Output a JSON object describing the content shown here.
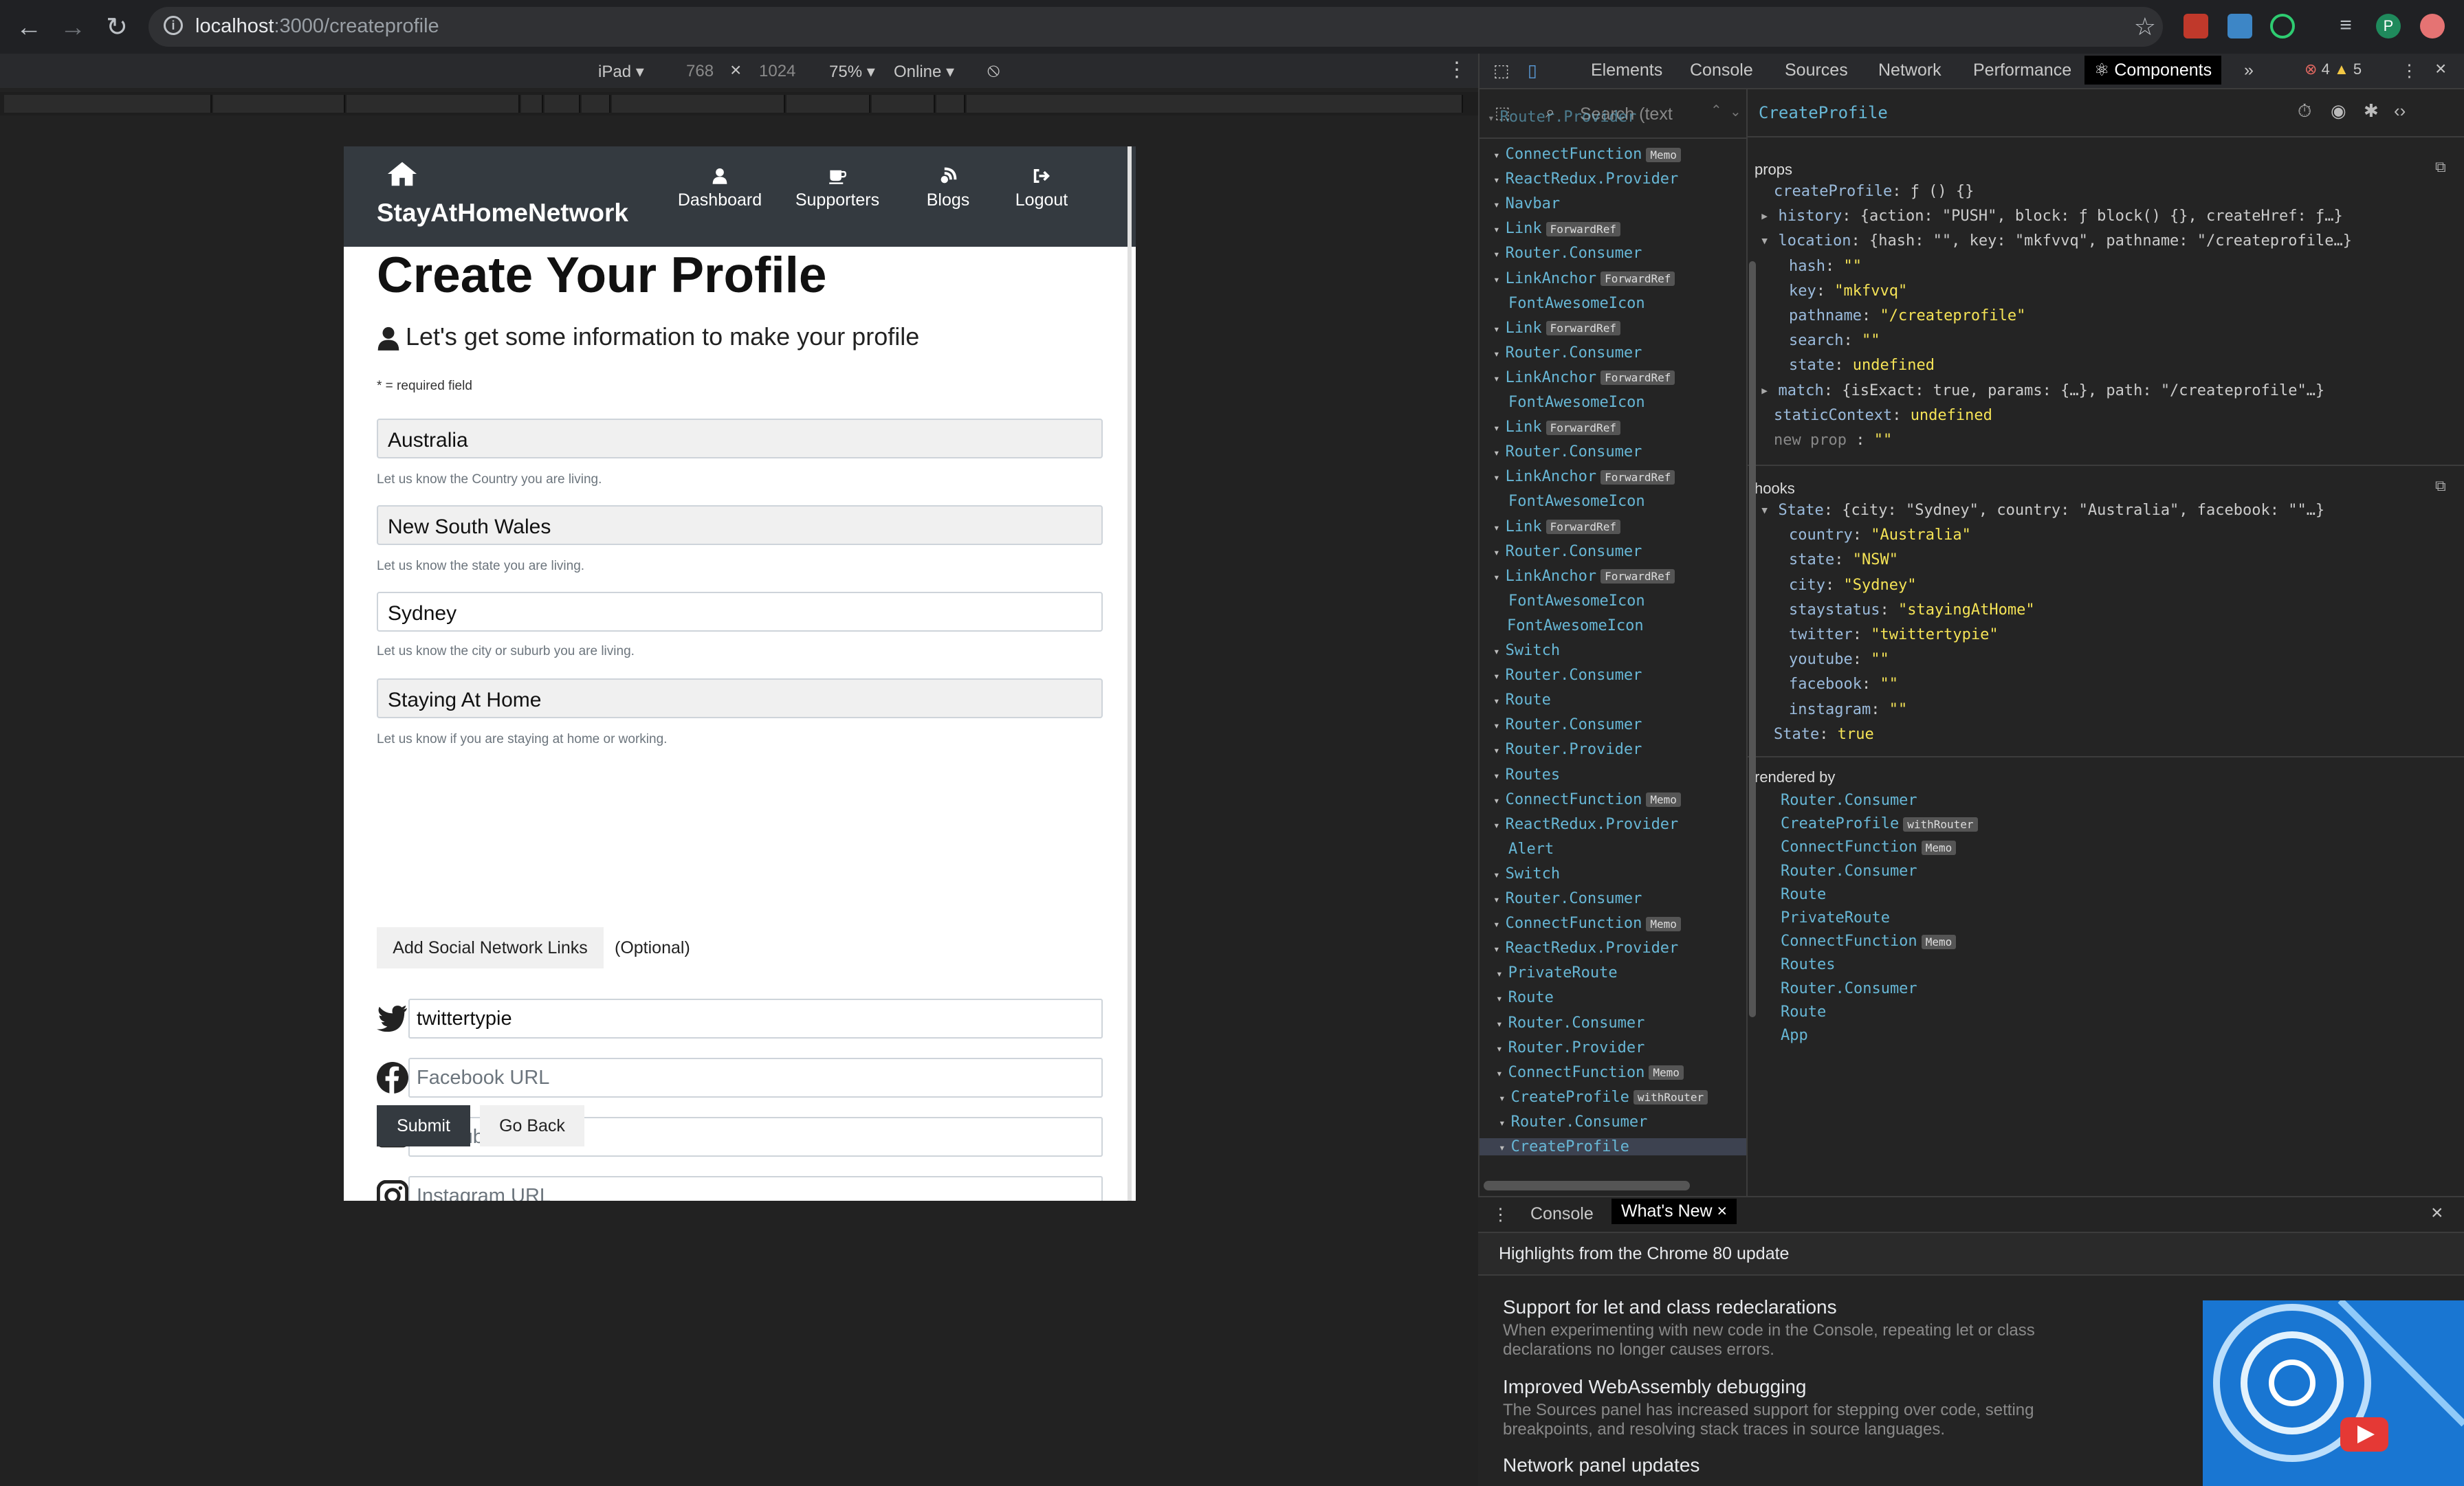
{
  "browser": {
    "url_host": "localhost",
    "url_path": ":3000/createprofile",
    "profile_initial": "P"
  },
  "device_toolbar": {
    "device": "iPad ▾",
    "width": "768",
    "times": "×",
    "height": "1024",
    "zoom": "75% ▾",
    "network": "Online ▾"
  },
  "app": {
    "brand": "StayAtHomeNetwork",
    "nav": [
      "Dashboard",
      "Supporters",
      "Blogs",
      "Logout"
    ],
    "title": "Create Your Profile",
    "lead": "Let's get some information to make your profile",
    "required_note": "* = required field",
    "fields": [
      {
        "value": "Australia",
        "help": "Let us know the Country you are living."
      },
      {
        "value": "New South Wales",
        "help": "Let us know the state you are living."
      },
      {
        "value": "Sydney",
        "help": "Let us know the city or suburb you are living."
      },
      {
        "value": "Staying At Home",
        "help": "Let us know if you are staying at home or working."
      }
    ],
    "add_social": "Add Social Network Links",
    "optional": "(Optional)",
    "social": [
      {
        "value": "twittertypie",
        "placeholder": ""
      },
      {
        "value": "",
        "placeholder": "Facebook URL"
      },
      {
        "value": "",
        "placeholder": "YouTube URL"
      },
      {
        "value": "",
        "placeholder": "Instagram URL"
      }
    ],
    "submit": "Submit",
    "go_back": "Go Back"
  },
  "devtools": {
    "tabs": [
      "Elements",
      "Console",
      "Sources",
      "Network",
      "Performance",
      "⚛ Components"
    ],
    "more": "»",
    "errors": "4",
    "warnings": "5",
    "search_placeholder": "Search (text",
    "tree": [
      {
        "name": "Router.Provider",
        "badge": ""
      },
      {
        "name": "ConnectFunction",
        "badge": "Memo"
      },
      {
        "name": "ReactRedux.Provider",
        "badge": ""
      },
      {
        "name": "Navbar",
        "badge": ""
      },
      {
        "name": "Link",
        "badge": "ForwardRef"
      },
      {
        "name": "Router.Consumer",
        "badge": ""
      },
      {
        "name": "LinkAnchor",
        "badge": "ForwardRef"
      },
      {
        "name": "FontAwesomeIcon",
        "badge": ""
      },
      {
        "name": "Link",
        "badge": "ForwardRef"
      },
      {
        "name": "Router.Consumer",
        "badge": ""
      },
      {
        "name": "LinkAnchor",
        "badge": "ForwardRef"
      },
      {
        "name": "FontAwesomeIcon",
        "badge": ""
      },
      {
        "name": "Link",
        "badge": "ForwardRef"
      },
      {
        "name": "Router.Consumer",
        "badge": ""
      },
      {
        "name": "LinkAnchor",
        "badge": "ForwardRef"
      },
      {
        "name": "FontAwesomeIcon",
        "badge": ""
      },
      {
        "name": "Link",
        "badge": "ForwardRef"
      },
      {
        "name": "Router.Consumer",
        "badge": ""
      },
      {
        "name": "LinkAnchor",
        "badge": "ForwardRef"
      },
      {
        "name": "FontAwesomeIcon",
        "badge": ""
      },
      {
        "name": "FontAwesomeIcon",
        "badge": ""
      },
      {
        "name": "Switch",
        "badge": ""
      },
      {
        "name": "Router.Consumer",
        "badge": ""
      },
      {
        "name": "Route",
        "badge": ""
      },
      {
        "name": "Router.Consumer",
        "badge": ""
      },
      {
        "name": "Router.Provider",
        "badge": ""
      },
      {
        "name": "Routes",
        "badge": ""
      },
      {
        "name": "ConnectFunction",
        "badge": "Memo"
      },
      {
        "name": "ReactRedux.Provider",
        "badge": ""
      },
      {
        "name": "Alert",
        "badge": ""
      },
      {
        "name": "Switch",
        "badge": ""
      },
      {
        "name": "Router.Consumer",
        "badge": ""
      },
      {
        "name": "ConnectFunction",
        "badge": "Memo"
      },
      {
        "name": "ReactRedux.Provider",
        "badge": ""
      },
      {
        "name": "PrivateRoute",
        "badge": ""
      },
      {
        "name": "Route",
        "badge": ""
      },
      {
        "name": "Router.Consumer",
        "badge": ""
      },
      {
        "name": "Router.Provider",
        "badge": ""
      },
      {
        "name": "ConnectFunction",
        "badge": "Memo"
      },
      {
        "name": "CreateProfile",
        "badge": "withRouter"
      },
      {
        "name": "Router.Consumer",
        "badge": ""
      },
      {
        "name": "CreateProfile",
        "badge": ""
      }
    ],
    "selected_component": "CreateProfile",
    "props_label": "props",
    "props": [
      {
        "k": "createProfile",
        "v": "ƒ () {}",
        "vc": "plain"
      },
      {
        "k": "history",
        "v": "{action: \"PUSH\", block: ƒ block() {}, createHref: ƒ…}",
        "vc": "plain",
        "arrow": "▸"
      },
      {
        "k": "location",
        "v": "{hash: \"\", key: \"mkfvvq\", pathname: \"/createprofile…}",
        "vc": "plain",
        "arrow": "▾"
      },
      {
        "k": "hash",
        "v": "\"\"",
        "vc": "s",
        "indent": true
      },
      {
        "k": "key",
        "v": "\"mkfvvq\"",
        "vc": "s",
        "indent": true
      },
      {
        "k": "pathname",
        "v": "\"/createprofile\"",
        "vc": "s",
        "indent": true
      },
      {
        "k": "search",
        "v": "\"\"",
        "vc": "s",
        "indent": true
      },
      {
        "k": "state",
        "v": "undefined",
        "vc": "s",
        "indent": true
      },
      {
        "k": "match",
        "v": "{isExact: true, params: {…}, path: \"/createprofile\"…}",
        "vc": "plain",
        "arrow": "▸"
      },
      {
        "k": "staticContext",
        "v": "undefined",
        "vc": "s"
      },
      {
        "k": "new prop",
        "v": "\"\"",
        "vc": "s",
        "dimkey": true
      }
    ],
    "hooks_label": "hooks",
    "hooks": [
      {
        "k": "State",
        "v": "{city: \"Sydney\", country: \"Australia\", facebook: \"\"…}",
        "vc": "plain",
        "arrow": "▾"
      },
      {
        "k": "country",
        "v": "\"Australia\"",
        "vc": "s",
        "indent": true
      },
      {
        "k": "state",
        "v": "\"NSW\"",
        "vc": "s",
        "indent": true
      },
      {
        "k": "city",
        "v": "\"Sydney\"",
        "vc": "s",
        "indent": true
      },
      {
        "k": "staystatus",
        "v": "\"stayingAtHome\"",
        "vc": "s",
        "indent": true
      },
      {
        "k": "twitter",
        "v": "\"twittertypie\"",
        "vc": "s",
        "indent": true
      },
      {
        "k": "youtube",
        "v": "\"\"",
        "vc": "s",
        "indent": true
      },
      {
        "k": "facebook",
        "v": "\"\"",
        "vc": "s",
        "indent": true
      },
      {
        "k": "instagram",
        "v": "\"\"",
        "vc": "s",
        "indent": true
      },
      {
        "k": "State",
        "v": "true",
        "vc": "s"
      }
    ],
    "rendered_by_label": "rendered by",
    "rendered_by": [
      {
        "name": "Router.Consumer",
        "badge": ""
      },
      {
        "name": "CreateProfile",
        "badge": "withRouter"
      },
      {
        "name": "ConnectFunction",
        "badge": "Memo"
      },
      {
        "name": "Router.Consumer",
        "badge": ""
      },
      {
        "name": "Route",
        "badge": ""
      },
      {
        "name": "PrivateRoute",
        "badge": ""
      },
      {
        "name": "ConnectFunction",
        "badge": "Memo"
      },
      {
        "name": "Routes",
        "badge": ""
      },
      {
        "name": "Router.Consumer",
        "badge": ""
      },
      {
        "name": "Route",
        "badge": ""
      },
      {
        "name": "App",
        "badge": ""
      }
    ],
    "drawer": {
      "tab_console": "Console",
      "tab_whatsnew": "What's New",
      "close": "×",
      "highlights": "Highlights from the Chrome 80 update",
      "items": [
        {
          "h": "Support for let and class redeclarations",
          "d": "When experimenting with new code in the Console, repeating let or class declarations no longer causes errors."
        },
        {
          "h": "Improved WebAssembly debugging",
          "d": "The Sources panel has increased support for stepping over code, setting breakpoints, and resolving stack traces in source languages."
        },
        {
          "h": "Network panel updates",
          "d": ""
        }
      ]
    }
  }
}
